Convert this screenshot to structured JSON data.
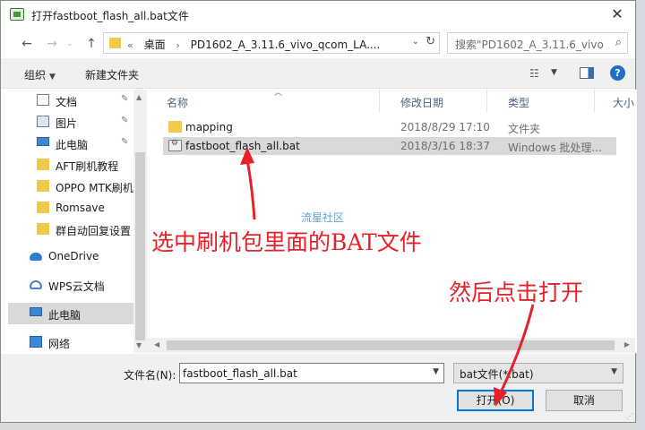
{
  "window": {
    "title": "打开fastboot_flash_all.bat文件",
    "close_label": "✕"
  },
  "nav": {
    "back": "←",
    "forward": "→",
    "up": "↑"
  },
  "address": {
    "chevron": "«",
    "segments": [
      "桌面",
      "PD1602_A_3.11.6_vivo_qcom_LA...."
    ],
    "separator": "›",
    "dropdown": "⌄",
    "refresh": "↻"
  },
  "search": {
    "placeholder": "搜索\"PD1602_A_3.11.6_vivo...",
    "icon": "search-icon"
  },
  "toolbar": {
    "organize": "组织",
    "organize_caret": "▼",
    "new_folder": "新建文件夹",
    "view_caret": "▼",
    "help": "?"
  },
  "sidebar": {
    "items": [
      {
        "label": "文档",
        "icon": "document-icon",
        "pinned": true
      },
      {
        "label": "图片",
        "icon": "pictures-icon",
        "pinned": true
      },
      {
        "label": "此电脑",
        "icon": "computer-icon",
        "pinned": true
      },
      {
        "label": "AFT刷机教程",
        "icon": "folder-icon",
        "pinned": false
      },
      {
        "label": "OPPO MTK刷机",
        "icon": "folder-icon",
        "pinned": false
      },
      {
        "label": "Romsave",
        "icon": "folder-icon",
        "pinned": false
      },
      {
        "label": "群自动回复设置",
        "icon": "folder-icon",
        "pinned": false
      },
      {
        "label": "OneDrive",
        "icon": "onedrive-icon",
        "pinned": false
      },
      {
        "label": "WPS云文档",
        "icon": "wps-cloud-icon",
        "pinned": false
      },
      {
        "label": "此电脑",
        "icon": "computer-icon",
        "pinned": false,
        "selected": true
      },
      {
        "label": "网络",
        "icon": "network-icon",
        "pinned": false
      }
    ],
    "pin_glyph": "📌"
  },
  "columns": {
    "name": "名称",
    "date": "修改日期",
    "type": "类型",
    "size": "大小"
  },
  "files": [
    {
      "name": "mapping",
      "date": "2018/8/29 17:10",
      "type": "文件夹",
      "icon": "folder-icon"
    },
    {
      "name": "fastboot_flash_all.bat",
      "date": "2018/3/16 18:37",
      "type": "Windows 批处理...",
      "icon": "batch-file-icon",
      "selected": true
    }
  ],
  "watermark": "流星社区",
  "annotations": {
    "select_bat": "选中刷机包里面的BAT文件",
    "then_open": "然后点击打开",
    "arrow_color": "#e8202a"
  },
  "footer": {
    "filename_label": "文件名(N):",
    "filename_value": "fastboot_flash_all.bat",
    "filter_value": "bat文件(*.bat)",
    "open_label": "打开(O)",
    "cancel_label": "取消"
  }
}
